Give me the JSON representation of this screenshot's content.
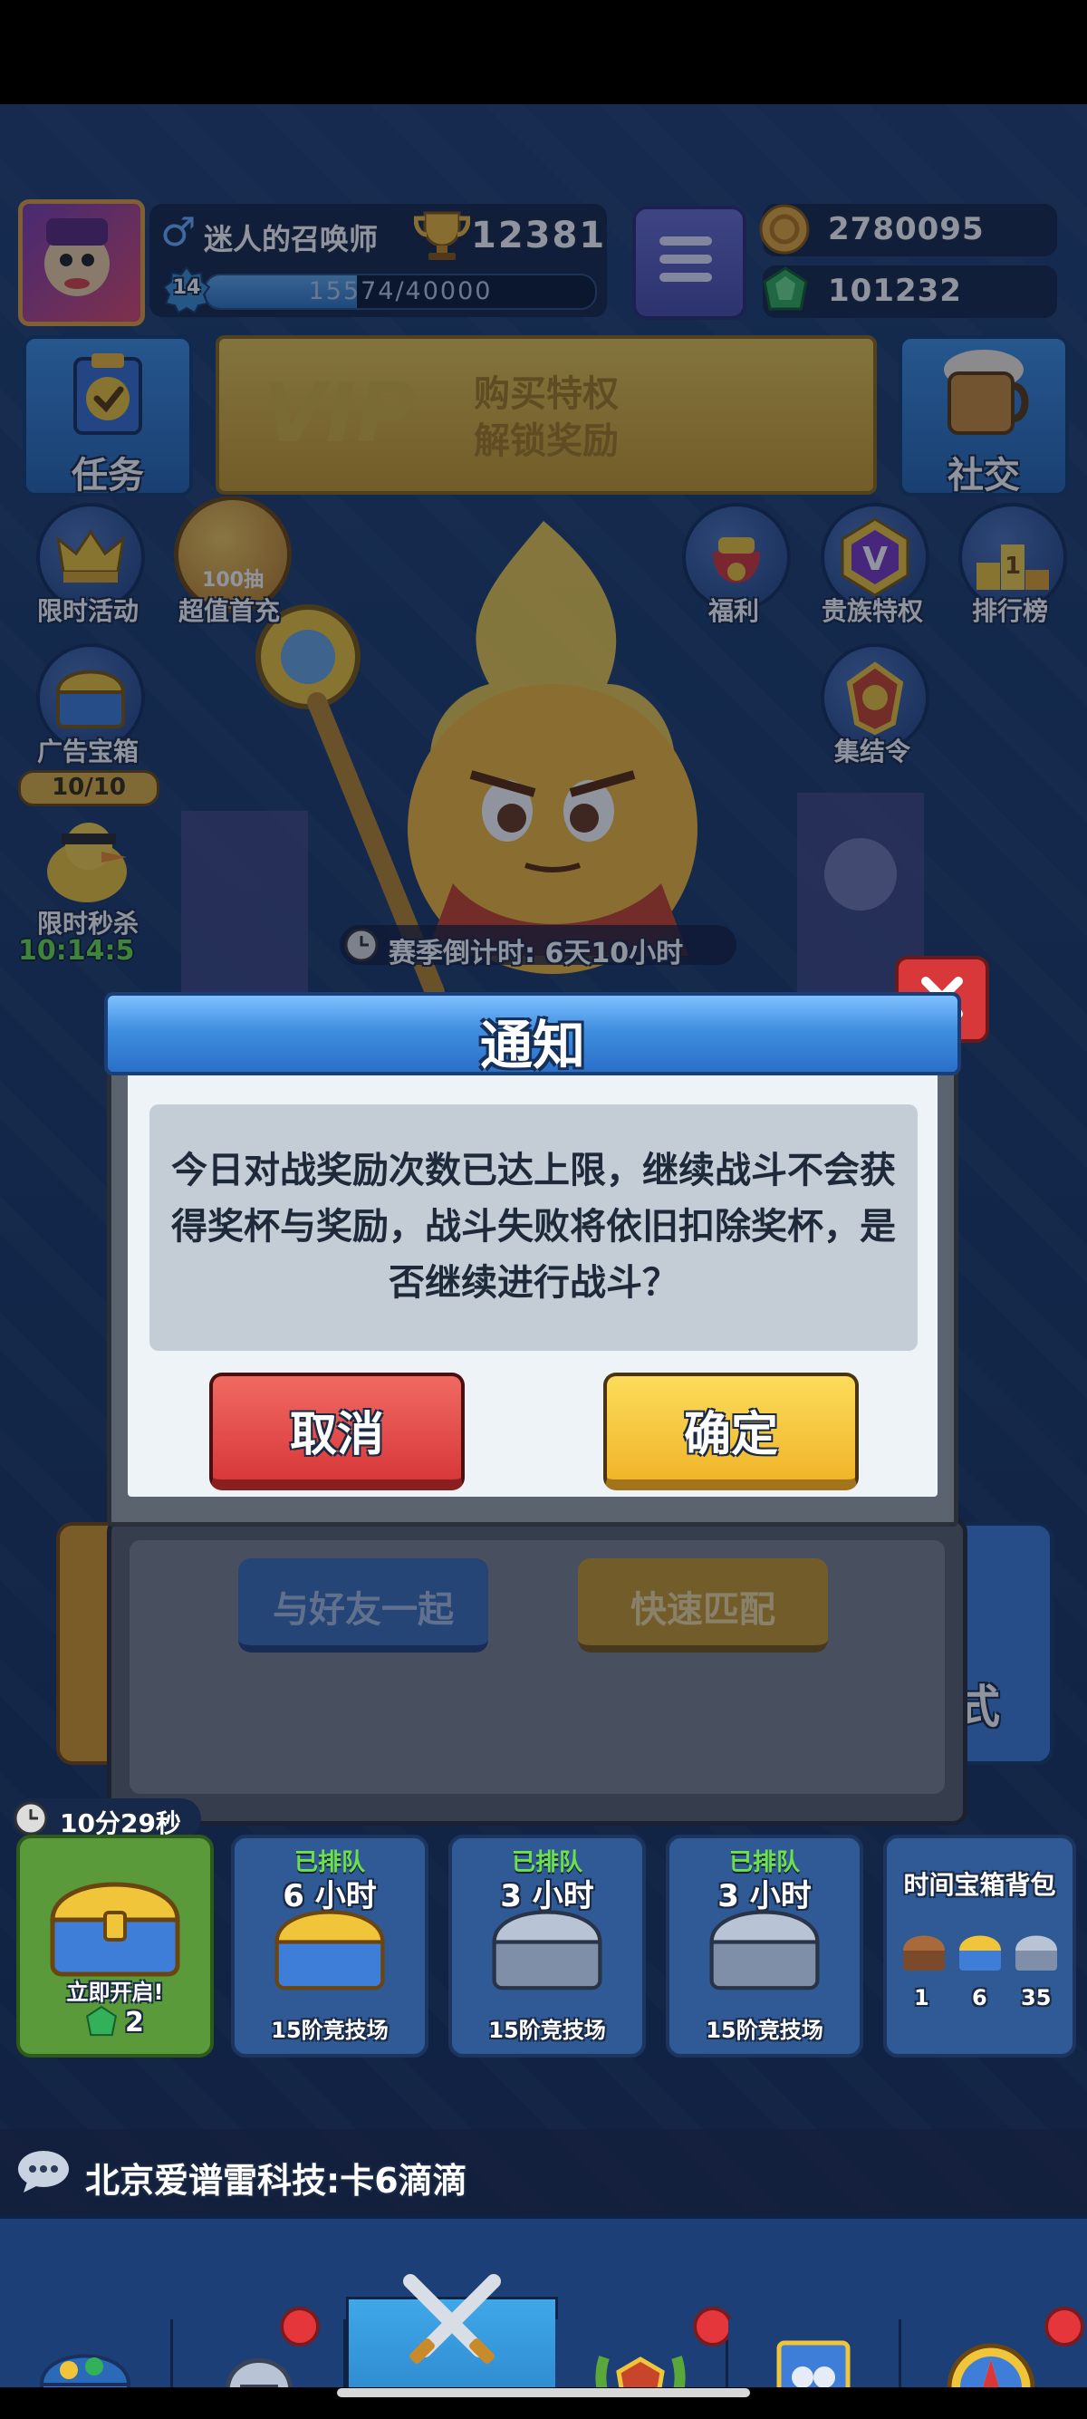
{
  "player": {
    "name": "迷人的召唤师",
    "gender_symbol": "♂",
    "trophies": "12381",
    "level": "14",
    "xp": "15574/40000",
    "xp_fraction": 0.389
  },
  "currency": {
    "gold": "2780095",
    "gems": "101232"
  },
  "top_buttons": {
    "tasks": "任务",
    "vip_line1": "购买特权",
    "vip_line2": "解锁奖励",
    "vip_badge": "VIP",
    "social": "社交"
  },
  "left_icons": [
    {
      "label": "限时活动",
      "icon": "crown-icon"
    },
    {
      "label": "超值首充",
      "icon": "coin-100-icon",
      "badge": "100抽"
    },
    {
      "label": "广告宝箱",
      "icon": "chest-icon",
      "counter": "10/10"
    },
    {
      "label": "限时秒杀",
      "icon": "duck-icon",
      "timer": "10:14:5"
    }
  ],
  "right_icons": [
    {
      "label": "福利",
      "icon": "gift-bag-icon"
    },
    {
      "label": "贵族特权",
      "icon": "noble-v-icon"
    },
    {
      "label": "排行榜",
      "icon": "podium-icon"
    },
    {
      "label": "集结令",
      "icon": "rally-emblem-icon"
    }
  ],
  "season": {
    "countdown": "赛季倒计时: 6天10小时"
  },
  "dialog": {
    "title": "通知",
    "message": "今日对战奖励次数已达上限，继续战斗不会获得奖杯与奖励，战斗失败将依旧扣除奖杯，是否继续进行战斗？",
    "cancel": "取消",
    "confirm": "确定"
  },
  "behind_panel": {
    "with_friend": "与好友一起",
    "quick_match": "快速匹配",
    "mode_partial": "式"
  },
  "chests": {
    "free_timer": "10分29秒",
    "free_label": "立即开启!",
    "free_cost": "2",
    "slots": [
      {
        "status": "已排队",
        "time": "6 小时",
        "arena": "15阶竞技场"
      },
      {
        "status": "已排队",
        "time": "3 小时",
        "arena": "15阶竞技场"
      },
      {
        "status": "已排队",
        "time": "3 小时",
        "arena": "15阶竞技场"
      }
    ],
    "bag_title": "时间宝箱背包",
    "bag_counts": [
      "1",
      "6",
      "35"
    ]
  },
  "chat": {
    "message": "北京爱谱雷科技:卡6滴滴"
  },
  "nav": {
    "battle": "战斗"
  },
  "colors": {
    "dialog_title_bar": "#3f8fe0",
    "cancel_button": "#e04a48",
    "confirm_button": "#f5c534",
    "gold": "#e6a93a",
    "gem": "#33b05a"
  }
}
